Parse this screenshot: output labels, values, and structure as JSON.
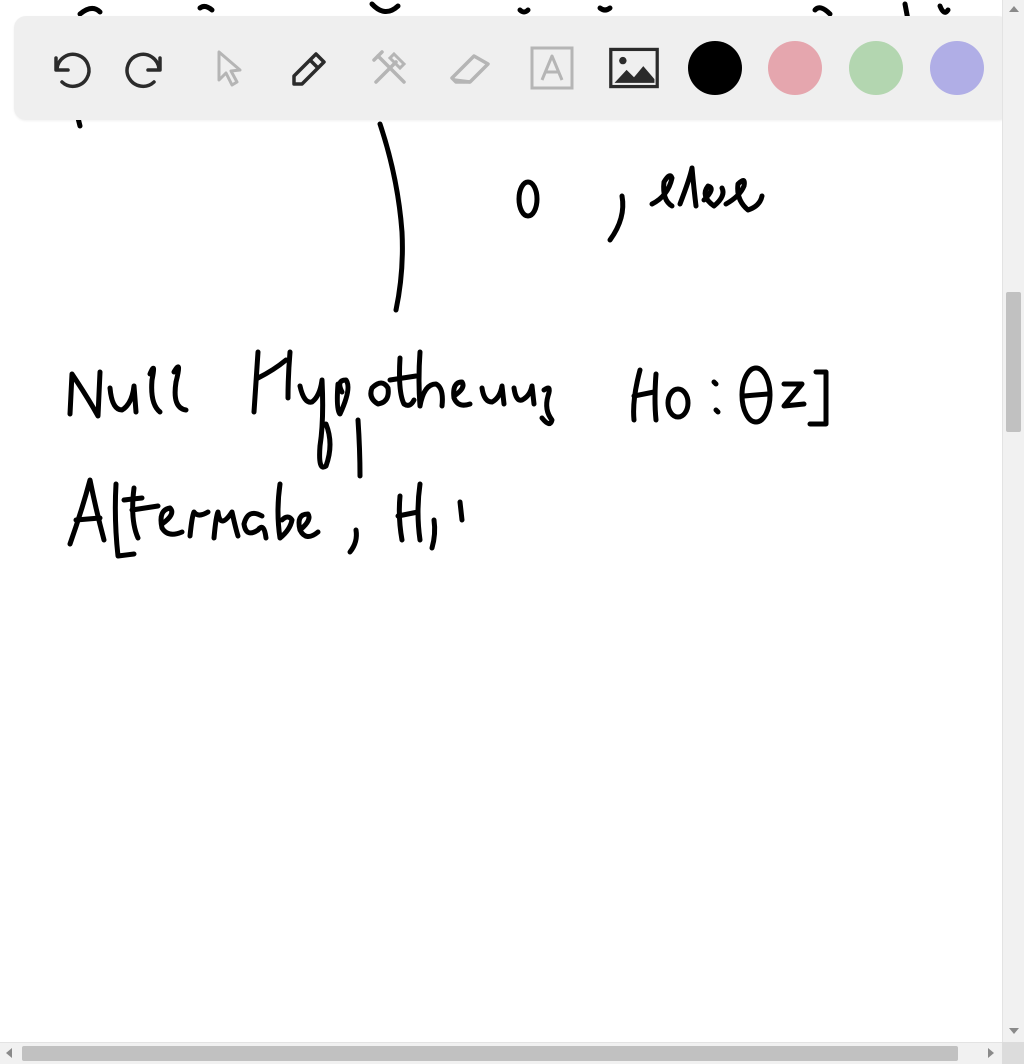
{
  "app": {
    "canvas_background": "#ffffff",
    "ink_color": "#000000"
  },
  "toolbar": {
    "background": "#efefef",
    "tools": [
      {
        "name": "undo",
        "icon": "undo-icon",
        "enabled": true
      },
      {
        "name": "redo",
        "icon": "redo-icon",
        "enabled": true
      },
      {
        "name": "select",
        "icon": "cursor-arrow-icon",
        "enabled": false
      },
      {
        "name": "pen",
        "icon": "pencil-icon",
        "enabled": true
      },
      {
        "name": "tools",
        "icon": "crossed-tools-icon",
        "enabled": false
      },
      {
        "name": "eraser",
        "icon": "eraser-icon",
        "enabled": false
      },
      {
        "name": "text",
        "icon": "text-box-icon",
        "enabled": false
      },
      {
        "name": "image",
        "icon": "image-icon",
        "enabled": true
      }
    ],
    "colors": [
      {
        "name": "black",
        "hex": "#000000",
        "selected": true
      },
      {
        "name": "red",
        "hex": "#e5a6ae"
      },
      {
        "name": "green",
        "hex": "#b3d6b0"
      },
      {
        "name": "purple",
        "hex": "#b0aee6"
      }
    ]
  },
  "scrollbars": {
    "vertical": {
      "position_fraction": 0.28
    },
    "horizontal": {
      "position_fraction": 0.0
    }
  }
}
